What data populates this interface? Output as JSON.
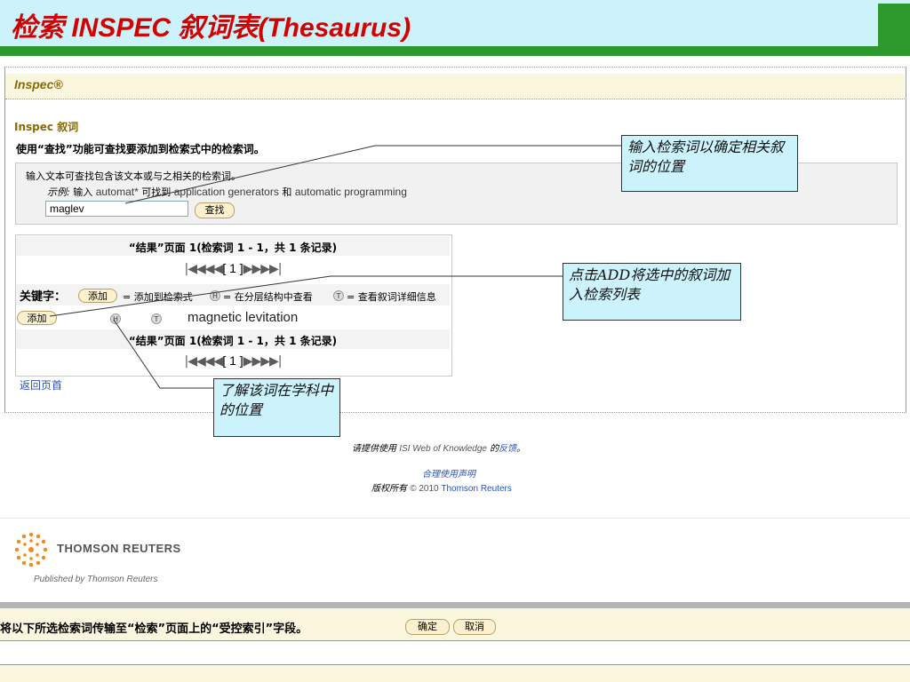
{
  "slide": {
    "title": "检索 INSPEC 叙词表(Thesaurus)"
  },
  "inspec": {
    "logo": "Inspec®",
    "thesaurus_title": "Inspec 叙词",
    "instruction": "使用“查找”功能可查找要添加到检索式中的检索词。",
    "search": {
      "hint": "输入文本可查找包含该文本或与之相关的检索词。",
      "example_label": "示例:",
      "example_enter": " 输入 ",
      "example_term": "automat*",
      "example_finds": " 可找到 ",
      "example_result1": "application generators",
      "example_and": " 和 ",
      "example_result2": "automatic programming",
      "input_value": "maglev",
      "find_button": "查找"
    },
    "results": {
      "summary": "“结果”页面 1(检索词 1 - 1，共 1 条记录)",
      "page_nav": "[ 1 ]",
      "keyword_label": "关键字：",
      "add_pill": "添加",
      "add_desc": "= 添加到检索式",
      "h_icon": "H",
      "h_desc": "= 在分层结构中查看",
      "t_icon": "T",
      "t_desc": "= 查看叙词详细信息",
      "term": {
        "add_button": "添加",
        "h_icon": "H",
        "t_icon": "T",
        "text": "magnetic levitation"
      }
    },
    "back_link": "返回页首",
    "footer": {
      "feedback_pre": "请提供使用 ",
      "feedback_product": "ISI Web of Knowledge",
      "feedback_mid": " 的",
      "feedback_link": "反馈",
      "feedback_end": "。",
      "fair_use": "合理使用声明",
      "copyright_pre": "版权所有 ",
      "copyright_year": "© 2010 ",
      "copyright_owner": "Thomson Reuters"
    },
    "brand": {
      "name": "THOMSON REUTERS",
      "published": "Published by Thomson Reuters"
    }
  },
  "transfer_bar": {
    "text": "将以下所选检索词传输至“检索”页面上的“受控索引”字段。",
    "ok_button": "确定",
    "cancel_button": "取消",
    "field_value": ""
  },
  "callouts": {
    "callout1": "输入检索词以确定相关叙词的位置",
    "callout2": "点击ADD将选中的叙词加入检索列表",
    "callout3": "了解该词在学科中的位置"
  },
  "colors": {
    "title_red": "#d40000",
    "title_bg": "#ccf2fb",
    "green_rule": "#2e9a2e",
    "header_bg": "#fbf7df",
    "link_blue": "#2a52be",
    "callout_bg": "#ccf2fb"
  },
  "icons": {
    "first_page": "first-page-icon",
    "prev_page": "prev-page-icon",
    "next_page": "next-page-icon",
    "last_page": "last-page-icon",
    "hierarchy": "hierarchy-h-icon",
    "term_details": "term-details-t-icon",
    "brand_logo": "thomson-reuters-logo-icon"
  }
}
